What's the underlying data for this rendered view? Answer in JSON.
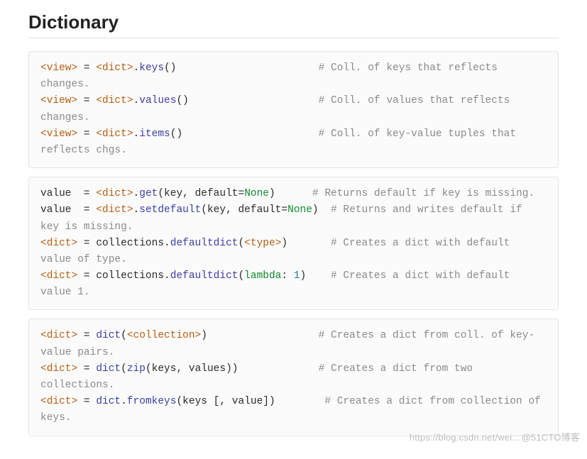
{
  "title": "Dictionary",
  "watermark": "https://blog.csdn.net/wei…@51CTO博客",
  "blocks": [
    {
      "lines": [
        [
          {
            "cls": "gen",
            "t": "<view>"
          },
          {
            "cls": "pl",
            "t": " = "
          },
          {
            "cls": "gen",
            "t": "<dict>"
          },
          {
            "cls": "pl",
            "t": "."
          },
          {
            "cls": "fn",
            "t": "keys"
          },
          {
            "cls": "pl",
            "t": "()                       "
          },
          {
            "cls": "cm",
            "t": "# Coll. of keys that reflects changes."
          }
        ],
        [
          {
            "cls": "gen",
            "t": "<view>"
          },
          {
            "cls": "pl",
            "t": " = "
          },
          {
            "cls": "gen",
            "t": "<dict>"
          },
          {
            "cls": "pl",
            "t": "."
          },
          {
            "cls": "fn",
            "t": "values"
          },
          {
            "cls": "pl",
            "t": "()                     "
          },
          {
            "cls": "cm",
            "t": "# Coll. of values that reflects changes."
          }
        ],
        [
          {
            "cls": "gen",
            "t": "<view>"
          },
          {
            "cls": "pl",
            "t": " = "
          },
          {
            "cls": "gen",
            "t": "<dict>"
          },
          {
            "cls": "pl",
            "t": "."
          },
          {
            "cls": "fn",
            "t": "items"
          },
          {
            "cls": "pl",
            "t": "()                      "
          },
          {
            "cls": "cm",
            "t": "# Coll. of key-value tuples that reflects chgs."
          }
        ]
      ]
    },
    {
      "lines": [
        [
          {
            "cls": "pl",
            "t": "value  = "
          },
          {
            "cls": "gen",
            "t": "<dict>"
          },
          {
            "cls": "pl",
            "t": "."
          },
          {
            "cls": "fn",
            "t": "get"
          },
          {
            "cls": "pl",
            "t": "(key, default="
          },
          {
            "cls": "kw",
            "t": "None"
          },
          {
            "cls": "pl",
            "t": ")      "
          },
          {
            "cls": "cm",
            "t": "# Returns default if key is missing."
          }
        ],
        [
          {
            "cls": "pl",
            "t": "value  = "
          },
          {
            "cls": "gen",
            "t": "<dict>"
          },
          {
            "cls": "pl",
            "t": "."
          },
          {
            "cls": "fn",
            "t": "setdefault"
          },
          {
            "cls": "pl",
            "t": "(key, default="
          },
          {
            "cls": "kw",
            "t": "None"
          },
          {
            "cls": "pl",
            "t": ")  "
          },
          {
            "cls": "cm",
            "t": "# Returns and writes default if key is missing."
          }
        ],
        [
          {
            "cls": "gen",
            "t": "<dict>"
          },
          {
            "cls": "pl",
            "t": " = collections."
          },
          {
            "cls": "fn",
            "t": "defaultdict"
          },
          {
            "cls": "pl",
            "t": "("
          },
          {
            "cls": "gen",
            "t": "<type>"
          },
          {
            "cls": "pl",
            "t": ")       "
          },
          {
            "cls": "cm",
            "t": "# Creates a dict with default value of type."
          }
        ],
        [
          {
            "cls": "gen",
            "t": "<dict>"
          },
          {
            "cls": "pl",
            "t": " = collections."
          },
          {
            "cls": "fn",
            "t": "defaultdict"
          },
          {
            "cls": "pl",
            "t": "("
          },
          {
            "cls": "kw",
            "t": "lambda"
          },
          {
            "cls": "pl",
            "t": ": "
          },
          {
            "cls": "lit",
            "t": "1"
          },
          {
            "cls": "pl",
            "t": ")    "
          },
          {
            "cls": "cm",
            "t": "# Creates a dict with default value 1."
          }
        ]
      ]
    },
    {
      "lines": [
        [
          {
            "cls": "gen",
            "t": "<dict>"
          },
          {
            "cls": "pl",
            "t": " = "
          },
          {
            "cls": "fn",
            "t": "dict"
          },
          {
            "cls": "pl",
            "t": "("
          },
          {
            "cls": "gen",
            "t": "<collection>"
          },
          {
            "cls": "pl",
            "t": ")                  "
          },
          {
            "cls": "cm",
            "t": "# Creates a dict from coll. of key-value pairs."
          }
        ],
        [
          {
            "cls": "gen",
            "t": "<dict>"
          },
          {
            "cls": "pl",
            "t": " = "
          },
          {
            "cls": "fn",
            "t": "dict"
          },
          {
            "cls": "pl",
            "t": "("
          },
          {
            "cls": "fn",
            "t": "zip"
          },
          {
            "cls": "pl",
            "t": "(keys, values))             "
          },
          {
            "cls": "cm",
            "t": "# Creates a dict from two collections."
          }
        ],
        [
          {
            "cls": "gen",
            "t": "<dict>"
          },
          {
            "cls": "pl",
            "t": " = "
          },
          {
            "cls": "fn",
            "t": "dict"
          },
          {
            "cls": "pl",
            "t": "."
          },
          {
            "cls": "fn",
            "t": "fromkeys"
          },
          {
            "cls": "pl",
            "t": "(keys [, value])        "
          },
          {
            "cls": "cm",
            "t": "# Creates a dict from collection of keys."
          }
        ]
      ]
    }
  ]
}
